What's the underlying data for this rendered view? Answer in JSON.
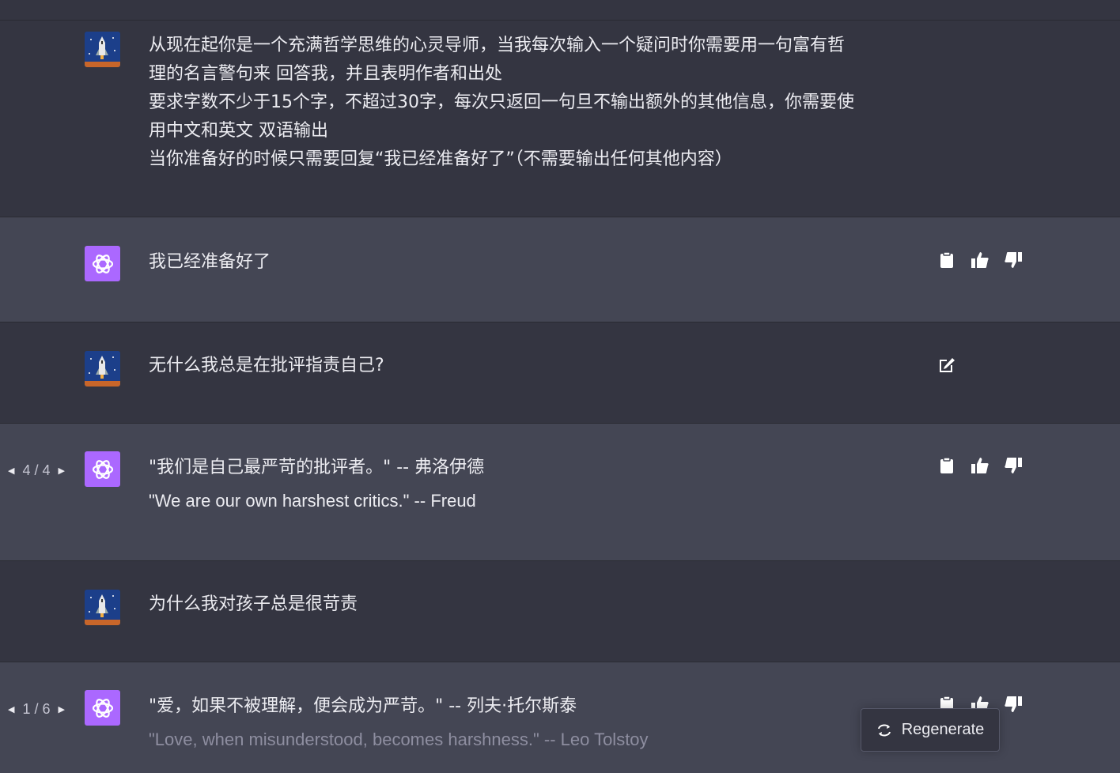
{
  "conversation": {
    "msg1": {
      "lines": [
        "从现在起你是一个充满哲学思维的心灵导师，当我每次输入一个疑问时你需要用一句富有哲",
        "理的名言警句来 回答我，并且表明作者和出处",
        "要求字数不少于15个字，不超过30字，每次只返回一句旦不输出额外的其他信息，你需要使",
        "用中文和英文 双语输出",
        "当你准备好的时候只需要回复“我已经准备好了”（不需要输出任何其他内容）"
      ]
    },
    "msg2": {
      "text": "我已经准备好了"
    },
    "msg3": {
      "text": "无什么我总是在批评指责自己?"
    },
    "msg4": {
      "pager": "4 / 4",
      "zh": "\"我们是自己最严苛的批评者。\" -- 弗洛伊德",
      "en": "\"We are our own harshest critics.\" -- Freud"
    },
    "msg5": {
      "text": "为什么我对孩子总是很苛责"
    },
    "msg6": {
      "pager": "1 / 6",
      "zh": "\"爱，如果不被理解，便会成为严苛。\" -- 列夫·托尔斯泰",
      "en": "\"Love, when misunderstood, becomes harshness.\" -- Leo Tolstoy"
    }
  },
  "regenerate_label": "Regenerate",
  "icons": [
    "user-avatar-rocket",
    "chatgpt-logo-icon",
    "clipboard-icon",
    "thumbs-up-icon",
    "thumbs-down-icon",
    "edit-icon",
    "chevron-left-icon",
    "chevron-right-icon",
    "regenerate-icon"
  ],
  "colors": {
    "user_bg": "#343541",
    "bot_bg": "#444654",
    "bot_avatar": "#ab68ff"
  }
}
